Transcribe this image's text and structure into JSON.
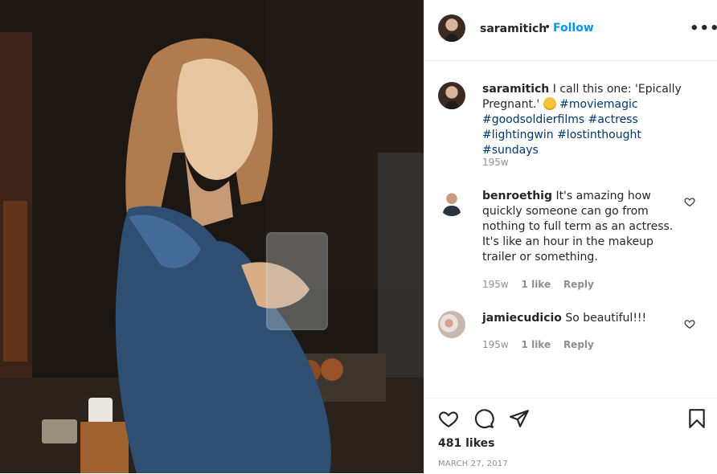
{
  "post": {
    "owner": "saramitich",
    "separator": "•",
    "follow_label": "Follow",
    "more_label": "•••"
  },
  "caption": {
    "username": "saramitich",
    "text": "I call this one: 'Epically Pregnant.'",
    "emoji": "winking-face",
    "hashtags": [
      "#moviemagic",
      "#goodsoldierfilms",
      "#actress",
      "#lightingwin",
      "#lostinthought",
      "#sundays"
    ],
    "age": "195w"
  },
  "comments": [
    {
      "username": "benroethig",
      "text": "It's amazing how quickly someone can go from nothing to full term as an actress. It's like an hour in the makeup trailer or something.",
      "age": "195w",
      "likes": "1 like",
      "reply": "Reply"
    },
    {
      "username": "jamiecudicio",
      "text": "So beautiful!!!",
      "age": "195w",
      "likes": "1 like",
      "reply": "Reply"
    }
  ],
  "footer": {
    "likes": "481 likes",
    "date": "MARCH 27, 2017"
  },
  "icons": {
    "like": "heart-icon",
    "comment": "comment-icon",
    "share": "paper-plane-icon",
    "save": "bookmark-icon",
    "comment_like": "heart-outline-icon"
  },
  "colors": {
    "link": "#0095f6",
    "hashtag": "#00376b",
    "muted": "#8e8e8e",
    "text": "#262626"
  }
}
